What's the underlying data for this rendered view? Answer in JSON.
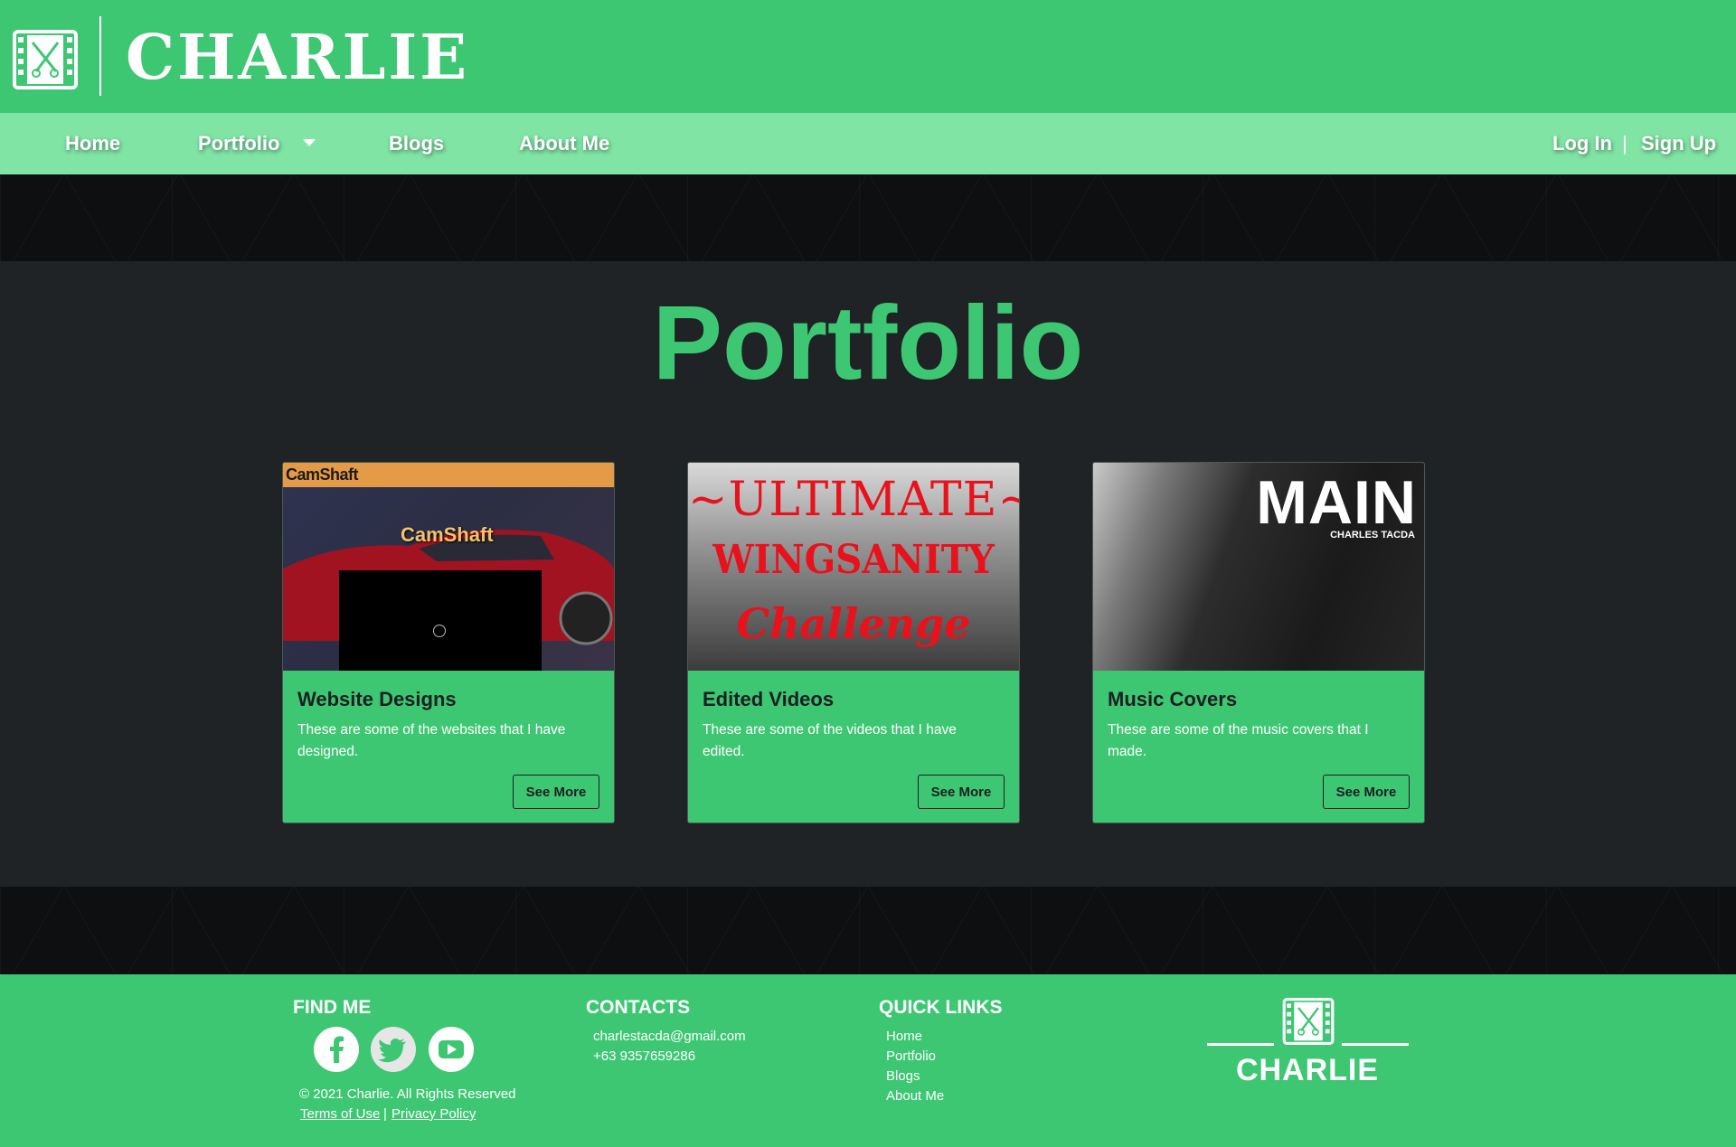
{
  "brand": {
    "name": "CHARLIE"
  },
  "nav": {
    "items": [
      {
        "label": "Home"
      },
      {
        "label": "Portfolio"
      },
      {
        "label": "Blogs"
      },
      {
        "label": "About Me"
      }
    ],
    "login": "Log In",
    "separator": "|",
    "signup": "Sign Up"
  },
  "main": {
    "title": "Portfolio",
    "cards": [
      {
        "title": "Website Designs",
        "text": "These are some of the websites that I have designed.",
        "button": "See More",
        "thumb": {
          "logo": "CamShaft",
          "overlay": "CamShaft"
        }
      },
      {
        "title": "Edited Videos",
        "text": "These are some of the videos that I have edited.",
        "button": "See More",
        "thumb": {
          "line1": "~ULTIMATE~",
          "line2": "WINGSANITY",
          "line3": "Challenge"
        }
      },
      {
        "title": "Music Covers",
        "text": "These are some of the music covers that I made.",
        "button": "See More",
        "thumb": {
          "main": "MAIN",
          "sub": "CHARLES TACDA"
        }
      }
    ]
  },
  "footer": {
    "find_me": {
      "heading": "FIND ME",
      "copyright": "© 2021 Charlie. All Rights Reserved",
      "terms": "Terms of Use",
      "sep": "|",
      "privacy": "Privacy Policy"
    },
    "contacts": {
      "heading": "CONTACTS",
      "email": "charlestacda@gmail.com",
      "phone": "+63 9357659286"
    },
    "quick_links": {
      "heading": "QUICK LINKS",
      "items": [
        "Home",
        "Portfolio",
        "Blogs",
        "About Me"
      ]
    },
    "logo_name": "CHARLIE"
  },
  "colors": {
    "brand_green": "#3ec773",
    "nav_green": "#80e4a5",
    "dark_bg": "#202326",
    "pattern_bg": "#0d0f11"
  },
  "icons": {
    "logo": "film-scissors-icon",
    "dropdown": "caret-down-icon",
    "social": [
      "facebook-icon",
      "twitter-icon",
      "youtube-icon"
    ]
  }
}
